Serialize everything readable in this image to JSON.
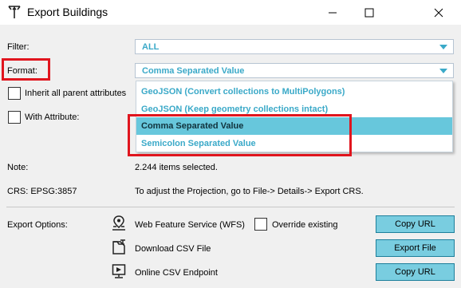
{
  "window": {
    "title": "Export Buildings",
    "minimize_icon": "minimize-icon",
    "maximize_icon": "maximize-icon",
    "close_icon": "close-icon"
  },
  "filter": {
    "label": "Filter:",
    "value": "ALL"
  },
  "format": {
    "label": "Format:",
    "value": "Comma Separated Value",
    "options": [
      "GeoJSON (Convert collections to MultiPolygons)",
      "GeoJSON (Keep geometry collections intact)",
      "Comma Separated Value",
      "Semicolon Separated Value"
    ],
    "selected_index": 2
  },
  "checkboxes": {
    "inherit": "Inherit all parent attributes",
    "with_attribute": "With Attribute:"
  },
  "info": {
    "note_label": "Note:",
    "note_value": "2.244 items selected.",
    "crs_label": "CRS: EPSG:3857",
    "crs_hint": "To adjust the Projection, go to File-> Details-> Export CRS."
  },
  "export": {
    "label": "Export Options:",
    "wfs_label": "Web Feature Service (WFS)",
    "override_label": "Override existing",
    "wfs_button": "Copy URL",
    "csv_label": "Download CSV File",
    "csv_button": "Export File",
    "endpoint_label": "Online CSV Endpoint",
    "endpoint_button": "Copy URL"
  },
  "colors": {
    "accent": "#3aa9c8",
    "selected_option": "#67c7dc",
    "button": "#79cde0",
    "highlight": "#e0151e"
  }
}
